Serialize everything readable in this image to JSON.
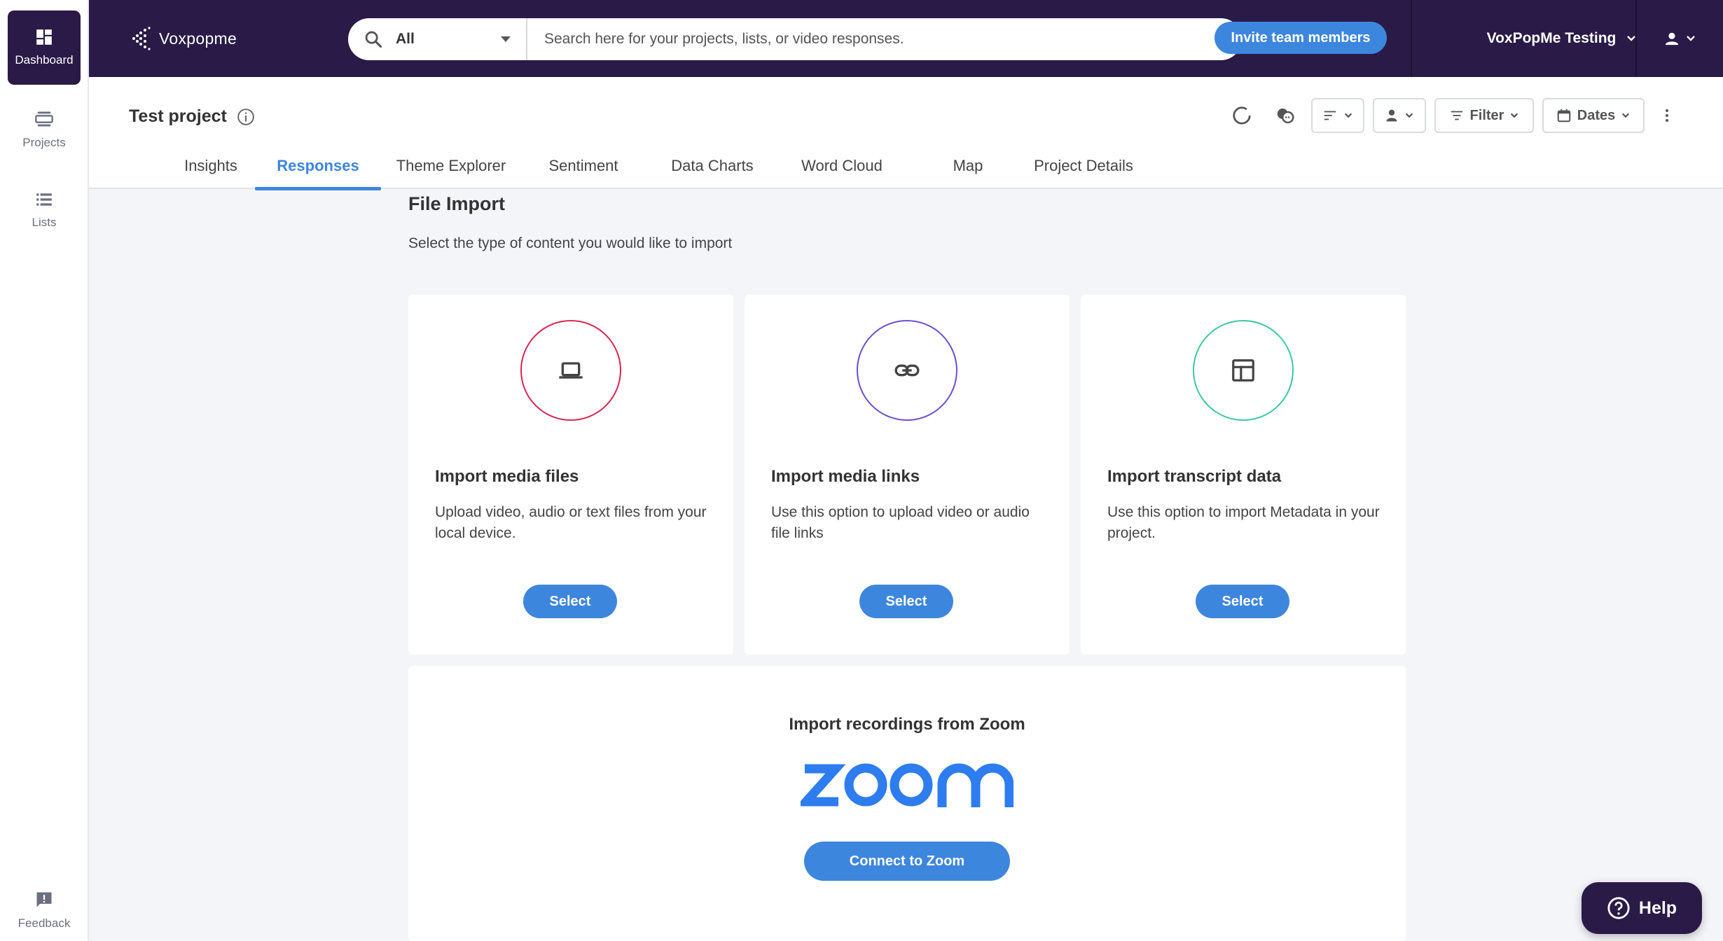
{
  "sidebar": {
    "items": [
      {
        "label": "Dashboard",
        "icon": "dashboard-icon",
        "active": true
      },
      {
        "label": "Projects",
        "icon": "projects-icon",
        "active": false
      },
      {
        "label": "Lists",
        "icon": "list-icon",
        "active": false
      }
    ],
    "feedback_label": "Feedback"
  },
  "topbar": {
    "logo_text": "Voxpopme",
    "search": {
      "scope": "All",
      "placeholder": "Search here for your projects, lists, or video responses."
    },
    "invite_label": "Invite team members",
    "workspace_name": "VoxPopMe Testing"
  },
  "project": {
    "title": "Test project",
    "toolbar": {
      "filter_label": "Filter",
      "dates_label": "Dates"
    },
    "tabs": [
      {
        "label": "Insights",
        "active": false
      },
      {
        "label": "Responses",
        "active": true
      },
      {
        "label": "Theme Explorer",
        "active": false
      },
      {
        "label": "Sentiment",
        "active": false
      },
      {
        "label": "Data Charts",
        "active": false
      },
      {
        "label": "Word Cloud",
        "active": false
      },
      {
        "label": "Map",
        "active": false
      },
      {
        "label": "Project Details",
        "active": false
      }
    ]
  },
  "file_import": {
    "title": "File Import",
    "subtitle": "Select the type of content you would like to import",
    "cards": [
      {
        "title": "Import media files",
        "description": "Upload video, audio or text files from your local device.",
        "button": "Select",
        "icon": "laptop-icon",
        "color": "#d9264f"
      },
      {
        "title": "Import media links",
        "description": "Use this option to upload video or audio file links",
        "button": "Select",
        "icon": "link-icon",
        "color": "#6b4fcf"
      },
      {
        "title": "Import transcript data",
        "description": "Use this option to import Metadata in your project.",
        "button": "Select",
        "icon": "table-icon",
        "color": "#3cc9a2"
      }
    ],
    "zoom": {
      "title": "Import recordings from Zoom",
      "logo_text": "zoom",
      "button": "Connect to Zoom"
    }
  },
  "help_label": "Help",
  "colors": {
    "navy": "#2a1a47",
    "accent": "#3d86de",
    "background": "#f4f5f9"
  }
}
